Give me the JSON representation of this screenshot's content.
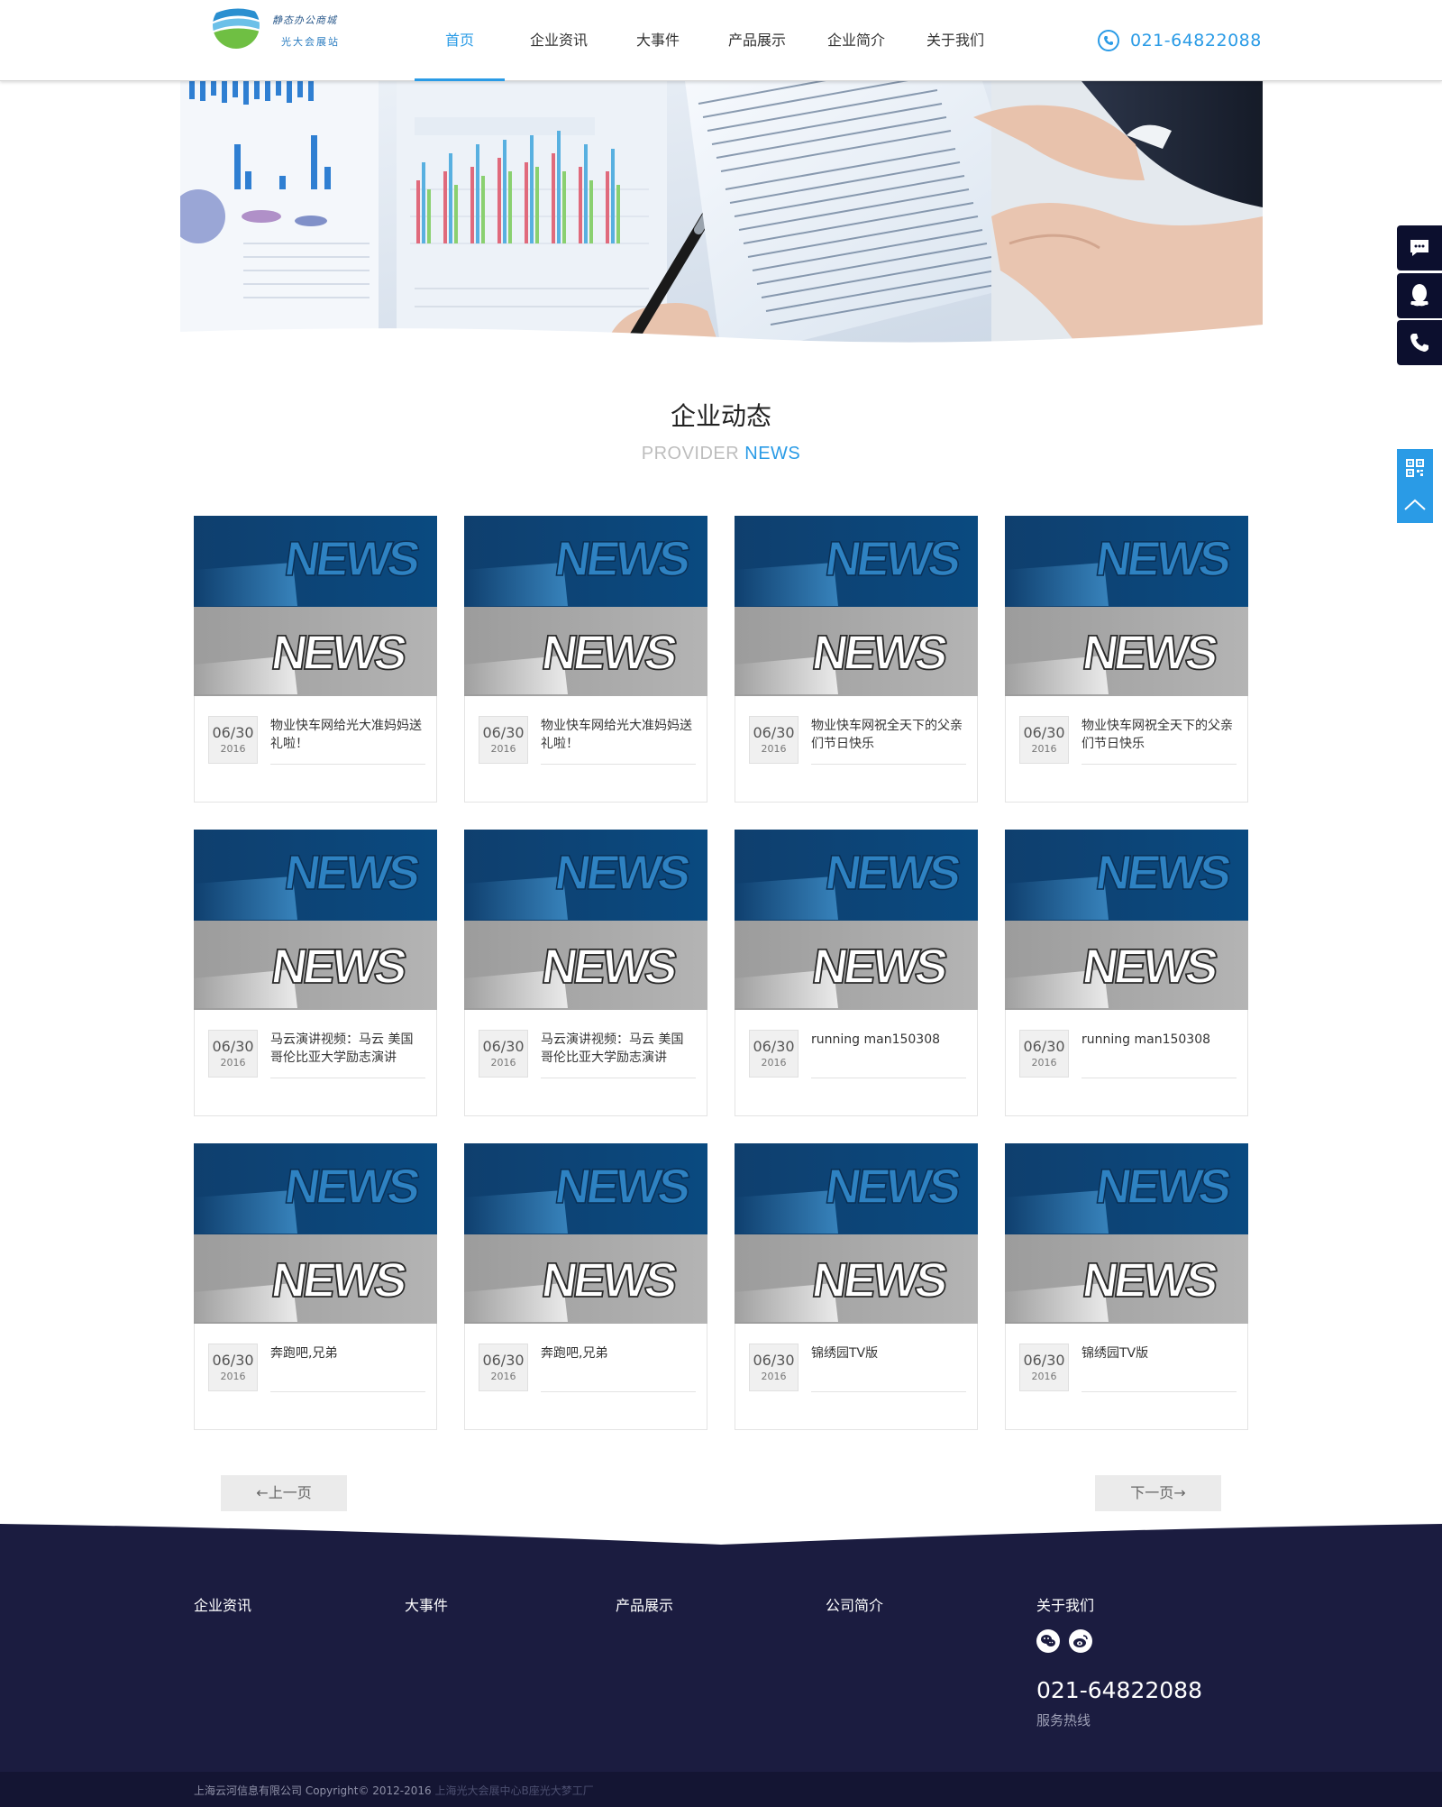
{
  "header": {
    "logo": {
      "line1": "静态办公商城",
      "line2": "光大会展站"
    },
    "nav": [
      {
        "label": "首页",
        "active": true
      },
      {
        "label": "企业资讯",
        "active": false
      },
      {
        "label": "大事件",
        "active": false
      },
      {
        "label": "产品展示",
        "active": false
      },
      {
        "label": "企业简介",
        "active": false
      },
      {
        "label": "关于我们",
        "active": false
      }
    ],
    "phone": "021-64822088"
  },
  "section": {
    "title": "企业动态",
    "subtitle_left": "PROVIDER",
    "subtitle_right": "NEWS"
  },
  "news": [
    {
      "md": "06/30",
      "year": "2016",
      "title": "物业快车网给光大准妈妈送礼啦！"
    },
    {
      "md": "06/30",
      "year": "2016",
      "title": "物业快车网给光大准妈妈送礼啦！"
    },
    {
      "md": "06/30",
      "year": "2016",
      "title": "物业快车网祝全天下的父亲们节日快乐"
    },
    {
      "md": "06/30",
      "year": "2016",
      "title": "物业快车网祝全天下的父亲们节日快乐"
    },
    {
      "md": "06/30",
      "year": "2016",
      "title": "马云演讲视频：马云 美国哥伦比亚大学励志演讲"
    },
    {
      "md": "06/30",
      "year": "2016",
      "title": "马云演讲视频：马云 美国哥伦比亚大学励志演讲"
    },
    {
      "md": "06/30",
      "year": "2016",
      "title": "running man150308"
    },
    {
      "md": "06/30",
      "year": "2016",
      "title": "running man150308"
    },
    {
      "md": "06/30",
      "year": "2016",
      "title": "奔跑吧,兄弟"
    },
    {
      "md": "06/30",
      "year": "2016",
      "title": "奔跑吧,兄弟"
    },
    {
      "md": "06/30",
      "year": "2016",
      "title": "锦绣园TV版"
    },
    {
      "md": "06/30",
      "year": "2016",
      "title": "锦绣园TV版"
    }
  ],
  "news_image_text": "NEWS",
  "pager": {
    "prev": "←上一页",
    "next": "下一页→"
  },
  "footer": {
    "columns": [
      "企业资讯",
      "大事件",
      "产品展示",
      "公司简介",
      "关于我们"
    ],
    "social_icons": [
      "wechat-icon",
      "weibo-icon"
    ],
    "phone": "021-64822088",
    "hotline_label": "服务热线",
    "copyright": "上海云河信息有限公司 Copyright© 2012-2016",
    "address": "上海光大会展中心B座光大梦工厂"
  },
  "side_widgets": [
    "message-icon",
    "qq-icon",
    "phone-icon",
    "qrcode-icon",
    "back-to-top-icon"
  ],
  "colors": {
    "accent": "#2a9be6",
    "footer": "#1b1c40",
    "footer_bottom": "#141533",
    "news_blue": "#0b4678",
    "news_gray": "#a4a4a4"
  }
}
